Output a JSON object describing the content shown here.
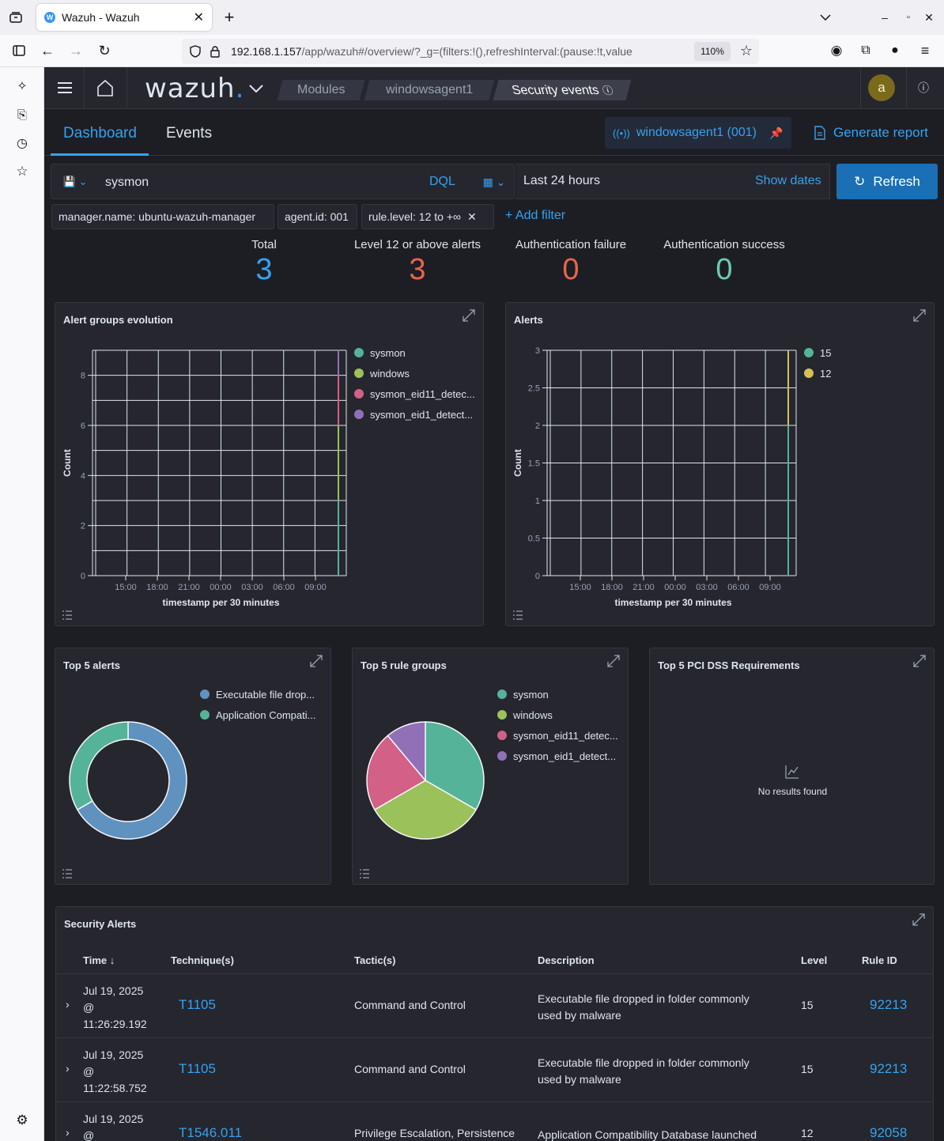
{
  "browser": {
    "tab_title": "Wazuh - Wazuh",
    "favicon_letter": "W",
    "url_host": "192.168.1.157",
    "url_rest": "/app/wazuh#/overview/?_g=(filters:!(),refreshInterval:(pause:!t,value",
    "zoom": "110%"
  },
  "header": {
    "logo": "wazuh",
    "breadcrumbs": [
      "Modules",
      "windowsagent1",
      "Security events"
    ],
    "avatar_letter": "a"
  },
  "page_tabs": {
    "dashboard": "Dashboard",
    "events": "Events",
    "active": "Dashboard"
  },
  "agent_badge": "windowsagent1 (001)",
  "generate_report": "Generate report",
  "search": {
    "query": "sysmon",
    "language": "DQL",
    "time_range": "Last 24 hours",
    "show_dates": "Show dates",
    "refresh": "Refresh"
  },
  "filters": [
    "manager.name: ubuntu-wazuh-manager",
    "agent.id: 001",
    "rule.level: 12 to +∞"
  ],
  "add_filter": "+ Add filter",
  "stats": [
    {
      "label": "Total",
      "value": "3",
      "color": "#36a2ef"
    },
    {
      "label": "Level 12 or above alerts",
      "value": "3",
      "color": "#e7664c"
    },
    {
      "label": "Authentication failure",
      "value": "0",
      "color": "#e7664c"
    },
    {
      "label": "Authentication success",
      "value": "0",
      "color": "#6dccb1"
    }
  ],
  "colors": {
    "accent": "#36a2ef",
    "refresh_bg": "#1a6fb5",
    "sysmon": "#54b399",
    "windows": "#9bc15a",
    "eid11": "#d36086",
    "eid1": "#9170b8",
    "level15": "#54b399",
    "level12": "#d6bf57",
    "donut_exec": "#6092c0",
    "donut_app": "#54b399"
  },
  "charts": {
    "alert_groups": {
      "title": "Alert groups evolution",
      "ylabel": "Count",
      "xlabel": "timestamp per 30 minutes",
      "y_ticks": [
        "0",
        "2",
        "4",
        "6",
        "8"
      ],
      "x_ticks": [
        "15:00",
        "18:00",
        "21:00",
        "00:00",
        "03:00",
        "06:00",
        "09:00"
      ],
      "legend": [
        "sysmon",
        "windows",
        "sysmon_eid11_detec...",
        "sysmon_eid1_detect..."
      ]
    },
    "alerts": {
      "title": "Alerts",
      "ylabel": "Count",
      "xlabel": "timestamp per 30 minutes",
      "y_ticks": [
        "0",
        "0.5",
        "1",
        "1.5",
        "2",
        "2.5",
        "3"
      ],
      "x_ticks": [
        "15:00",
        "18:00",
        "21:00",
        "00:00",
        "03:00",
        "06:00",
        "09:00"
      ],
      "legend": [
        "15",
        "12"
      ]
    },
    "top5_alerts": {
      "title": "Top 5 alerts",
      "legend": [
        "Executable file drop...",
        "Application Compati..."
      ]
    },
    "top5_rule_groups": {
      "title": "Top 5 rule groups",
      "legend": [
        "sysmon",
        "windows",
        "sysmon_eid11_detec...",
        "sysmon_eid1_detect..."
      ]
    },
    "top5_pci": {
      "title": "Top 5 PCI DSS Requirements",
      "empty": "No results found"
    }
  },
  "chart_data": [
    {
      "type": "area",
      "title": "Alert groups evolution",
      "xlabel": "timestamp per 30 minutes",
      "ylabel": "Count",
      "ylim": [
        0,
        9
      ],
      "x_ticks": [
        "15:00",
        "18:00",
        "21:00",
        "00:00",
        "03:00",
        "06:00",
        "09:00"
      ],
      "series": [
        {
          "name": "sysmon",
          "values": [
            3
          ]
        },
        {
          "name": "windows",
          "values": [
            3
          ]
        },
        {
          "name": "sysmon_eid11_detec...",
          "values": [
            2
          ]
        },
        {
          "name": "sysmon_eid1_detect...",
          "values": [
            1
          ]
        }
      ]
    },
    {
      "type": "area",
      "title": "Alerts",
      "xlabel": "timestamp per 30 minutes",
      "ylabel": "Count",
      "ylim": [
        0,
        3
      ],
      "x_ticks": [
        "15:00",
        "18:00",
        "21:00",
        "00:00",
        "03:00",
        "06:00",
        "09:00"
      ],
      "series": [
        {
          "name": "15",
          "values": [
            2
          ]
        },
        {
          "name": "12",
          "values": [
            1
          ]
        }
      ]
    },
    {
      "type": "pie",
      "title": "Top 5 alerts",
      "categories": [
        "Executable file drop...",
        "Application Compati..."
      ],
      "values": [
        2,
        1
      ]
    },
    {
      "type": "pie",
      "title": "Top 5 rule groups",
      "categories": [
        "sysmon",
        "windows",
        "sysmon_eid11_detec...",
        "sysmon_eid1_detect..."
      ],
      "values": [
        3,
        3,
        2,
        1
      ]
    }
  ],
  "security_alerts": {
    "title": "Security Alerts",
    "columns": [
      "Time",
      "Technique(s)",
      "Tactic(s)",
      "Description",
      "Level",
      "Rule ID"
    ],
    "rows": [
      {
        "time1": "Jul 19, 2025",
        "time2": "@",
        "time3": "11:26:29.192",
        "technique": "T1105",
        "tactic": "Command and Control",
        "desc1": "Executable file dropped in folder commonly",
        "desc2": "used by malware",
        "level": "15",
        "rule_id": "92213"
      },
      {
        "time1": "Jul 19, 2025",
        "time2": "@",
        "time3": "11:22:58.752",
        "technique": "T1105",
        "tactic": "Command and Control",
        "desc1": "Executable file dropped in folder commonly",
        "desc2": "used by malware",
        "level": "15",
        "rule_id": "92213"
      },
      {
        "time1": "Jul 19, 2025",
        "time2": "@",
        "time3": "",
        "technique": "T1546.011",
        "tactic": "Privilege Escalation, Persistence",
        "desc1": "Application Compatibility Database launched",
        "desc2": "",
        "level": "12",
        "rule_id": "92058"
      }
    ]
  }
}
